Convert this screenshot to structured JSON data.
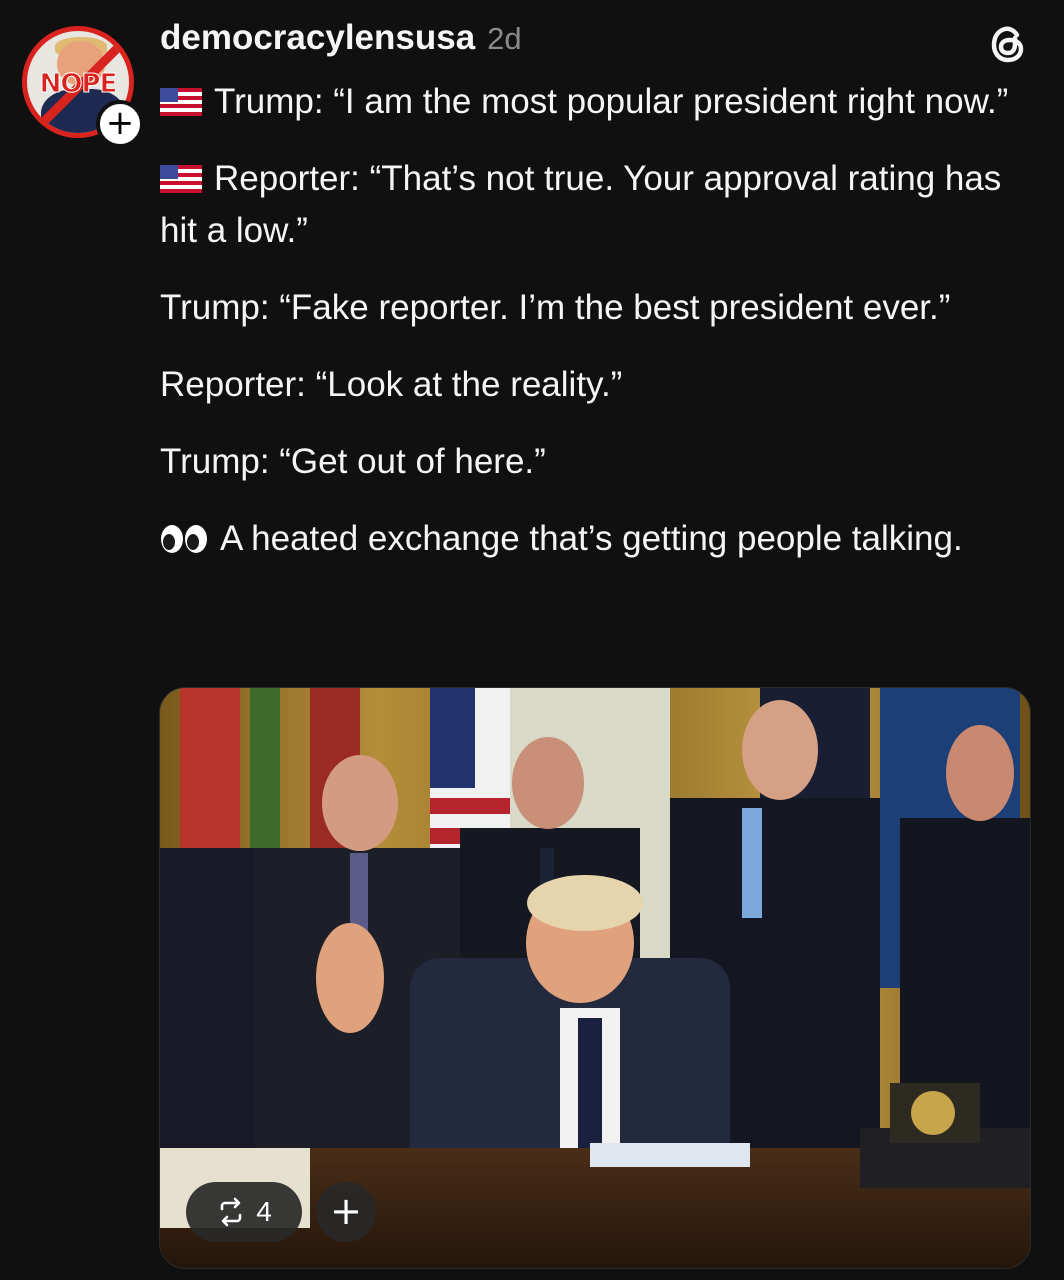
{
  "post": {
    "username": "democracylensusa",
    "timestamp": "2d",
    "avatar_text": "NOPE",
    "follow_symbol": "+",
    "paragraphs": [
      {
        "icon": "us-flag",
        "text": "Trump: “I am the most popular president right now.”"
      },
      {
        "icon": "us-flag",
        "text": "Reporter: “That’s not true. Your approval rating has hit a low.”"
      },
      {
        "icon": "",
        "text": "Trump: “Fake reporter. I’m the best president ever.”"
      },
      {
        "icon": "",
        "text": "Reporter: “Look at the reality.”"
      },
      {
        "icon": "",
        "text": "Trump: “Get out of here.”"
      },
      {
        "icon": "eyes",
        "text": "A heated exchange that’s getting people talking."
      }
    ]
  },
  "media": {
    "repost_count": "4",
    "add_symbol": "+"
  },
  "colors": {
    "background": "#101010",
    "text": "#f3f5f7",
    "muted": "#8a8a8a",
    "avatar_ring": "#d9231e"
  },
  "icons": [
    "threads-logo-icon",
    "us-flag-icon",
    "eyes-icon",
    "repost-icon",
    "plus-icon"
  ]
}
